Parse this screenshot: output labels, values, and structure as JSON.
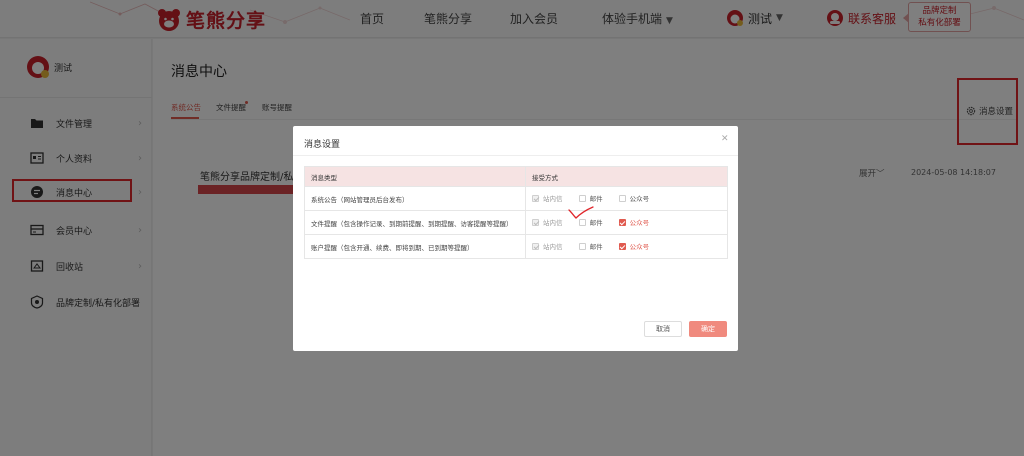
{
  "header": {
    "logo_text": "笔熊分享",
    "nav": [
      {
        "label": "首页"
      },
      {
        "label": "笔熊分享"
      },
      {
        "label": "加入会员"
      },
      {
        "label": "体验手机端"
      }
    ],
    "user_name": "测试",
    "service_label": "联系客服",
    "brand_promo_line1": "品牌定制",
    "brand_promo_line2": "私有化部署"
  },
  "sidebar": {
    "user_name": "测试",
    "items": [
      {
        "label": "文件管理",
        "icon": "folder-icon"
      },
      {
        "label": "个人资料",
        "icon": "id-card-icon"
      },
      {
        "label": "消息中心",
        "icon": "message-icon"
      },
      {
        "label": "会员中心",
        "icon": "card-icon"
      },
      {
        "label": "回收站",
        "icon": "recycle-bin-icon"
      },
      {
        "label": "品牌定制/私有化部署",
        "icon": "brand-icon"
      }
    ],
    "active_index": 2
  },
  "main": {
    "title": "消息中心",
    "tabs": [
      {
        "label": "系统公告"
      },
      {
        "label": "文件提醒"
      },
      {
        "label": "账号提醒"
      }
    ],
    "settings_label": "消息设置",
    "notice": {
      "title": "笔熊分享品牌定制/私有",
      "expand_label": "展开",
      "date": "2024-05-08 14:18:07"
    }
  },
  "modal": {
    "title": "消息设置",
    "headers": [
      "消息类型",
      "接受方式"
    ],
    "rows": [
      {
        "type": "系统公告（网站管理员后台发布）",
        "options": [
          {
            "label": "站内信",
            "checked": true,
            "disabled": true
          },
          {
            "label": "邮件",
            "checked": false,
            "disabled": false
          },
          {
            "label": "公众号",
            "checked": false,
            "disabled": false
          }
        ]
      },
      {
        "type": "文件提醒（包含操作记录、到期前提醒、到期提醒、访客提醒等提醒）",
        "options": [
          {
            "label": "站内信",
            "checked": true,
            "disabled": true
          },
          {
            "label": "邮件",
            "checked": false,
            "disabled": false
          },
          {
            "label": "公众号",
            "checked": true,
            "disabled": false
          }
        ]
      },
      {
        "type": "账户提醒（包含开通、续费、即将到期、已到期等提醒）",
        "options": [
          {
            "label": "站内信",
            "checked": true,
            "disabled": true
          },
          {
            "label": "邮件",
            "checked": false,
            "disabled": false
          },
          {
            "label": "公众号",
            "checked": true,
            "disabled": false
          }
        ]
      }
    ],
    "cancel_label": "取消",
    "confirm_label": "确定"
  },
  "colors": {
    "brand_red": "#c8202a",
    "accent": "#e05a4f",
    "highlight_border": "#e0262b",
    "confirm_bg": "#f08a7e"
  }
}
